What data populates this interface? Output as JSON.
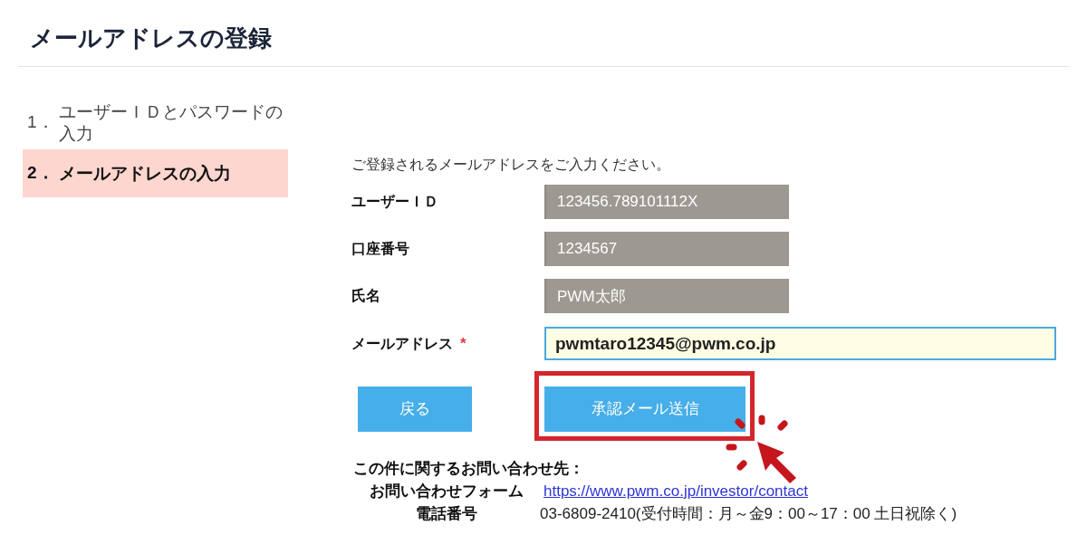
{
  "page": {
    "title": "メールアドレスの登録"
  },
  "steps": [
    {
      "number": "1．",
      "label": "ユーザーＩＤとパスワードの入力",
      "selected": false
    },
    {
      "number": "2．",
      "label": "メールアドレスの入力",
      "selected": true
    }
  ],
  "form": {
    "intro": "ご登録されるメールアドレスをご入力ください。",
    "fields": [
      {
        "label": "ユーザーＩＤ",
        "value": "123456.789101112X",
        "disabled": true
      },
      {
        "label": "口座番号",
        "value": "1234567",
        "disabled": true
      },
      {
        "label": "氏名",
        "value": "PWM太郎",
        "disabled": true
      },
      {
        "label": "メールアドレス",
        "required_mark": "*",
        "value": "pwmtaro12345@pwm.co.jp",
        "disabled": false
      }
    ]
  },
  "buttons": [
    {
      "label": "戻る",
      "highlighted": false
    },
    {
      "label": "承認メール送信",
      "highlighted": true
    }
  ],
  "contact": {
    "heading": "この件に関するお問い合わせ先：",
    "rows": [
      {
        "kind": "link",
        "label": "お問い合わせフォーム",
        "value": "https://www.pwm.co.jp/investor/contact"
      },
      {
        "kind": "text",
        "label": "電話番号",
        "value": "03-6809-2410(受付時間：月～金9：00～17：00 土日祝除く)"
      }
    ]
  }
}
